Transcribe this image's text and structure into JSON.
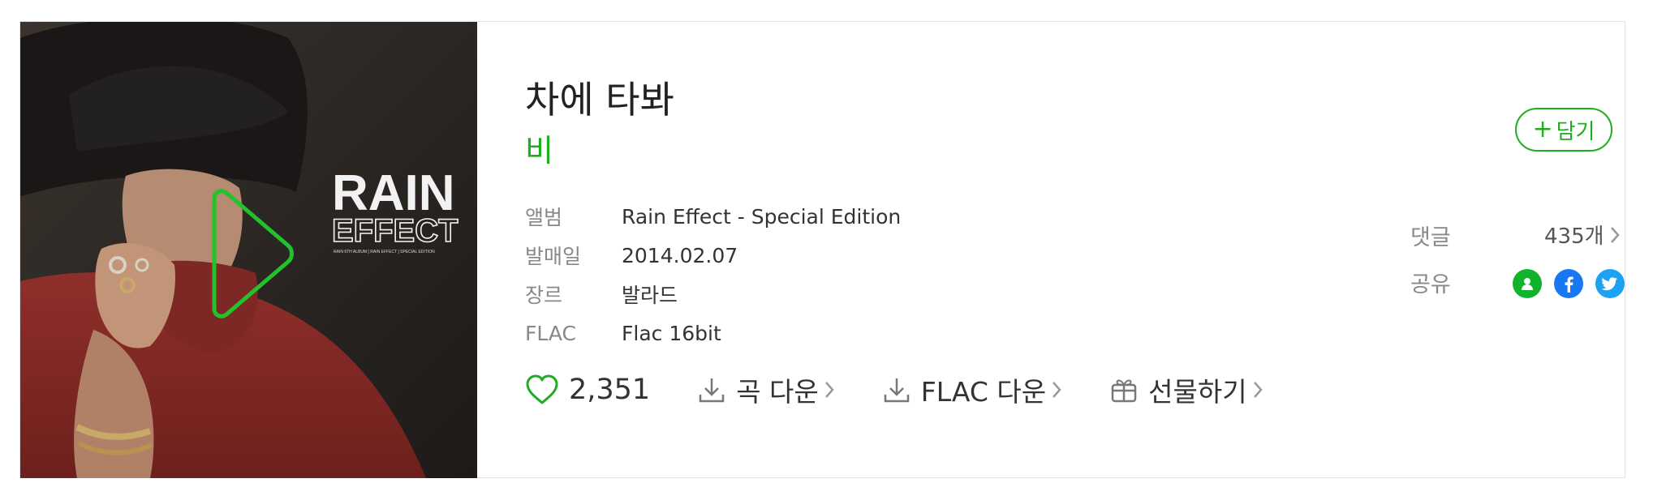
{
  "song": {
    "title": "차에 타봐",
    "artist": "비"
  },
  "cover": {
    "logo_line1": "RAIN",
    "logo_line2": "EFFECT",
    "logo_sub": "RAIN 6TH ALBUM [ RAIN EFFECT ] SPECIAL EDITION"
  },
  "meta": [
    {
      "key": "앨범",
      "value": "Rain Effect - Special Edition"
    },
    {
      "key": "발매일",
      "value": "2014.02.07"
    },
    {
      "key": "장르",
      "value": "발라드"
    },
    {
      "key": "FLAC",
      "value": "Flac 16bit"
    }
  ],
  "actions": {
    "like_count": "2,351",
    "song_download": "곡 다운",
    "flac_download": "FLAC 다운",
    "gift": "선물하기"
  },
  "side": {
    "add_label": "담기",
    "comment_label": "댓글",
    "comment_count": "435개",
    "share_label": "공유"
  },
  "colors": {
    "accent": "#1fae1f",
    "melon_share": "#12b32c",
    "facebook": "#1877f2",
    "twitter": "#1da1f2"
  }
}
